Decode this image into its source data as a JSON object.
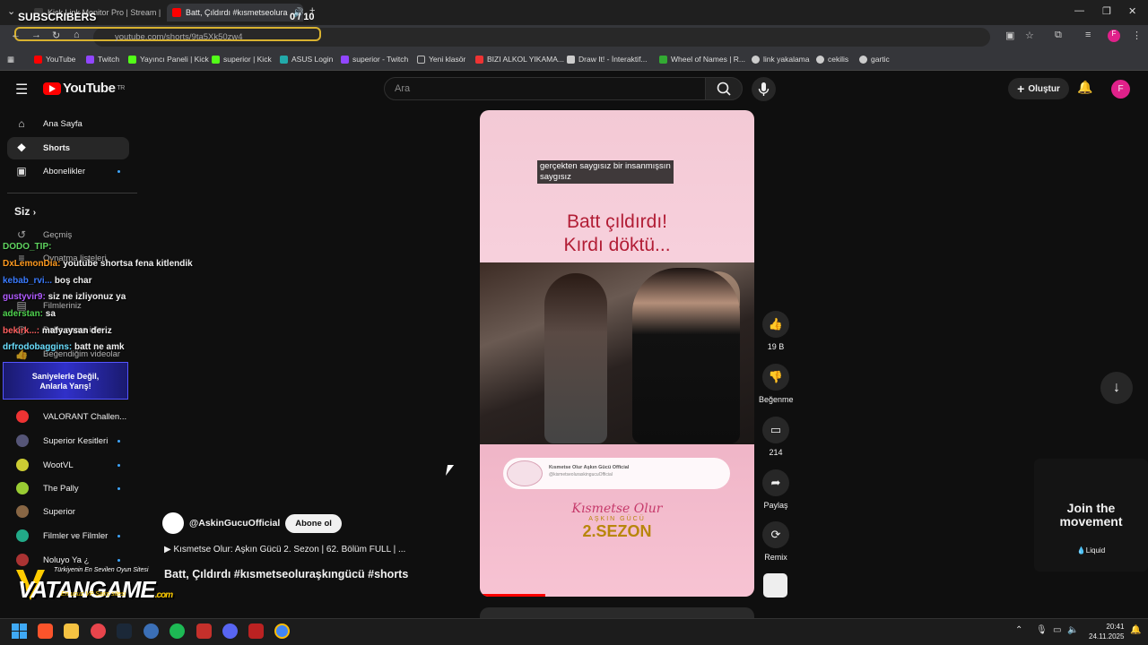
{
  "overlay": {
    "subs_label": "SUBSCRIBERS",
    "subs_count": "0 / 10"
  },
  "browser": {
    "tabs": [
      {
        "title": "Kick Link Monitor Pro | Stream |",
        "color": "#3a3a3a"
      },
      {
        "title": "Batt, Çıldırdı #kısmetseolura",
        "color": "#ff0000"
      }
    ],
    "url": "youtube.com/shorts/9ta5Xk50zw4",
    "bookmarks": [
      {
        "label": "YouTube",
        "color": "#ff0000"
      },
      {
        "label": "Twitch",
        "color": "#9146ff"
      },
      {
        "label": "Yayıncı Paneli | Kick",
        "color": "#53fc18"
      },
      {
        "label": "superior | Kick",
        "color": "#53fc18"
      },
      {
        "label": "ASUS Login",
        "color": "#2aa"
      },
      {
        "label": "superior - Twitch",
        "color": "#9146ff"
      },
      {
        "label": "Yeni klasör",
        "color": "#999"
      },
      {
        "label": "BIZI ALKOL YIKAMA...",
        "color": "#e33"
      },
      {
        "label": "Draw It! - İnteraktif...",
        "color": "#ccc"
      },
      {
        "label": "Wheel of Names | R...",
        "color": "#3a3"
      },
      {
        "label": "link yakalama",
        "color": "#ccc"
      },
      {
        "label": "cekilis",
        "color": "#ccc"
      },
      {
        "label": "gartic",
        "color": "#ccc"
      }
    ]
  },
  "header": {
    "logo": "YouTube",
    "region": "TR",
    "search_placeholder": "Ara",
    "create_label": "Oluştur",
    "avatar_letter": "F"
  },
  "sidebar": {
    "top": [
      {
        "label": "Ana Sayfa",
        "icon": "home-icon"
      },
      {
        "label": "Shorts",
        "icon": "shorts-icon"
      },
      {
        "label": "Abonelikler",
        "icon": "subscriptions-icon"
      }
    ],
    "siz_label": "Siz",
    "you": [
      {
        "label": "Geçmiş"
      },
      {
        "label": "Oynatma listeleri"
      },
      {
        "label": "Filmleriniz"
      },
      {
        "label": "Daha sonra izle"
      },
      {
        "label": "Beğendiğim videolar"
      }
    ],
    "channels": [
      {
        "label": "VALORANT Challen...",
        "color": "#e33"
      },
      {
        "label": "Superior Kesitleri",
        "color": "#557"
      },
      {
        "label": "WootVL",
        "color": "#cc3"
      },
      {
        "label": "The Pally",
        "color": "#9c3"
      },
      {
        "label": "Superior",
        "color": "#864"
      },
      {
        "label": "Filmler ve Filmler",
        "color": "#2a8"
      },
      {
        "label": "Noluyo Ya ¿",
        "color": "#a33"
      }
    ]
  },
  "chat": [
    {
      "user": "DODO_TIP:",
      "msg": "",
      "color": "#5fd35f"
    },
    {
      "user": "DxLemonDia:",
      "msg": "youtube shortsa fena kitlendik",
      "color": "#ff9a1f"
    },
    {
      "user": "kebab_rvi...",
      "msg": "boş char",
      "color": "#3a7bff"
    },
    {
      "user": "gustyvir9:",
      "msg": "siz ne izliyonuz ya",
      "color": "#b05bff"
    },
    {
      "user": "aderstan:",
      "msg": "sa",
      "color": "#4fd34f"
    },
    {
      "user": "bekirk...:",
      "msg": "mafyaysan deriz",
      "color": "#ff5f5f"
    },
    {
      "user": "drfrodobaggins:",
      "msg": "batt ne amk",
      "color": "#6adfff"
    }
  ],
  "promo": {
    "line1": "Saniyelerle Değil,",
    "line2": "Anlarla Yarış!",
    "vatan_top": "Türkiyenin En Sevilen Oyun Sitesi",
    "vatan_main": "VATANGAME",
    "vatan_com": ".com",
    "vatan_bottom": "En ucuz VP Satış sitesi"
  },
  "short": {
    "caption_line1": "gerçekten saygısız bir insanmışsın",
    "caption_line2": "saygısız",
    "headline_line1": "Batt çıldırdı!",
    "headline_line2": "Kırdı döktü...",
    "banner_title": "Kısmetse Olur Aşkın Gücü Official",
    "banner_handle": "@kismetseoluraskingucuOfficial",
    "logo_script": "Kısmetse Olur",
    "logo_sub": "AŞKIN GÜCÜ",
    "logo_season": "2.SEZON",
    "progress": 0.24
  },
  "actions": {
    "like": "19 B",
    "dislike": "Beğenme",
    "comments": "214",
    "share": "Paylaş",
    "remix": "Remix"
  },
  "channel": {
    "name": "@AskinGucuOfficial",
    "subscribe_label": "Abone ol",
    "playlist": "▶ Kısmetse Olur: Aşkın Gücü 2. Sezon | 62. Bölüm FULL | ...",
    "title": "Batt, Çıldırdı  #kısmetseoluraşkıngücü #shorts"
  },
  "ad": {
    "title_line1": "Join the",
    "title_line2": "movement",
    "brand": "💧Liquid"
  },
  "taskbar": {
    "time": "20:41",
    "date": "24.11.2025"
  }
}
